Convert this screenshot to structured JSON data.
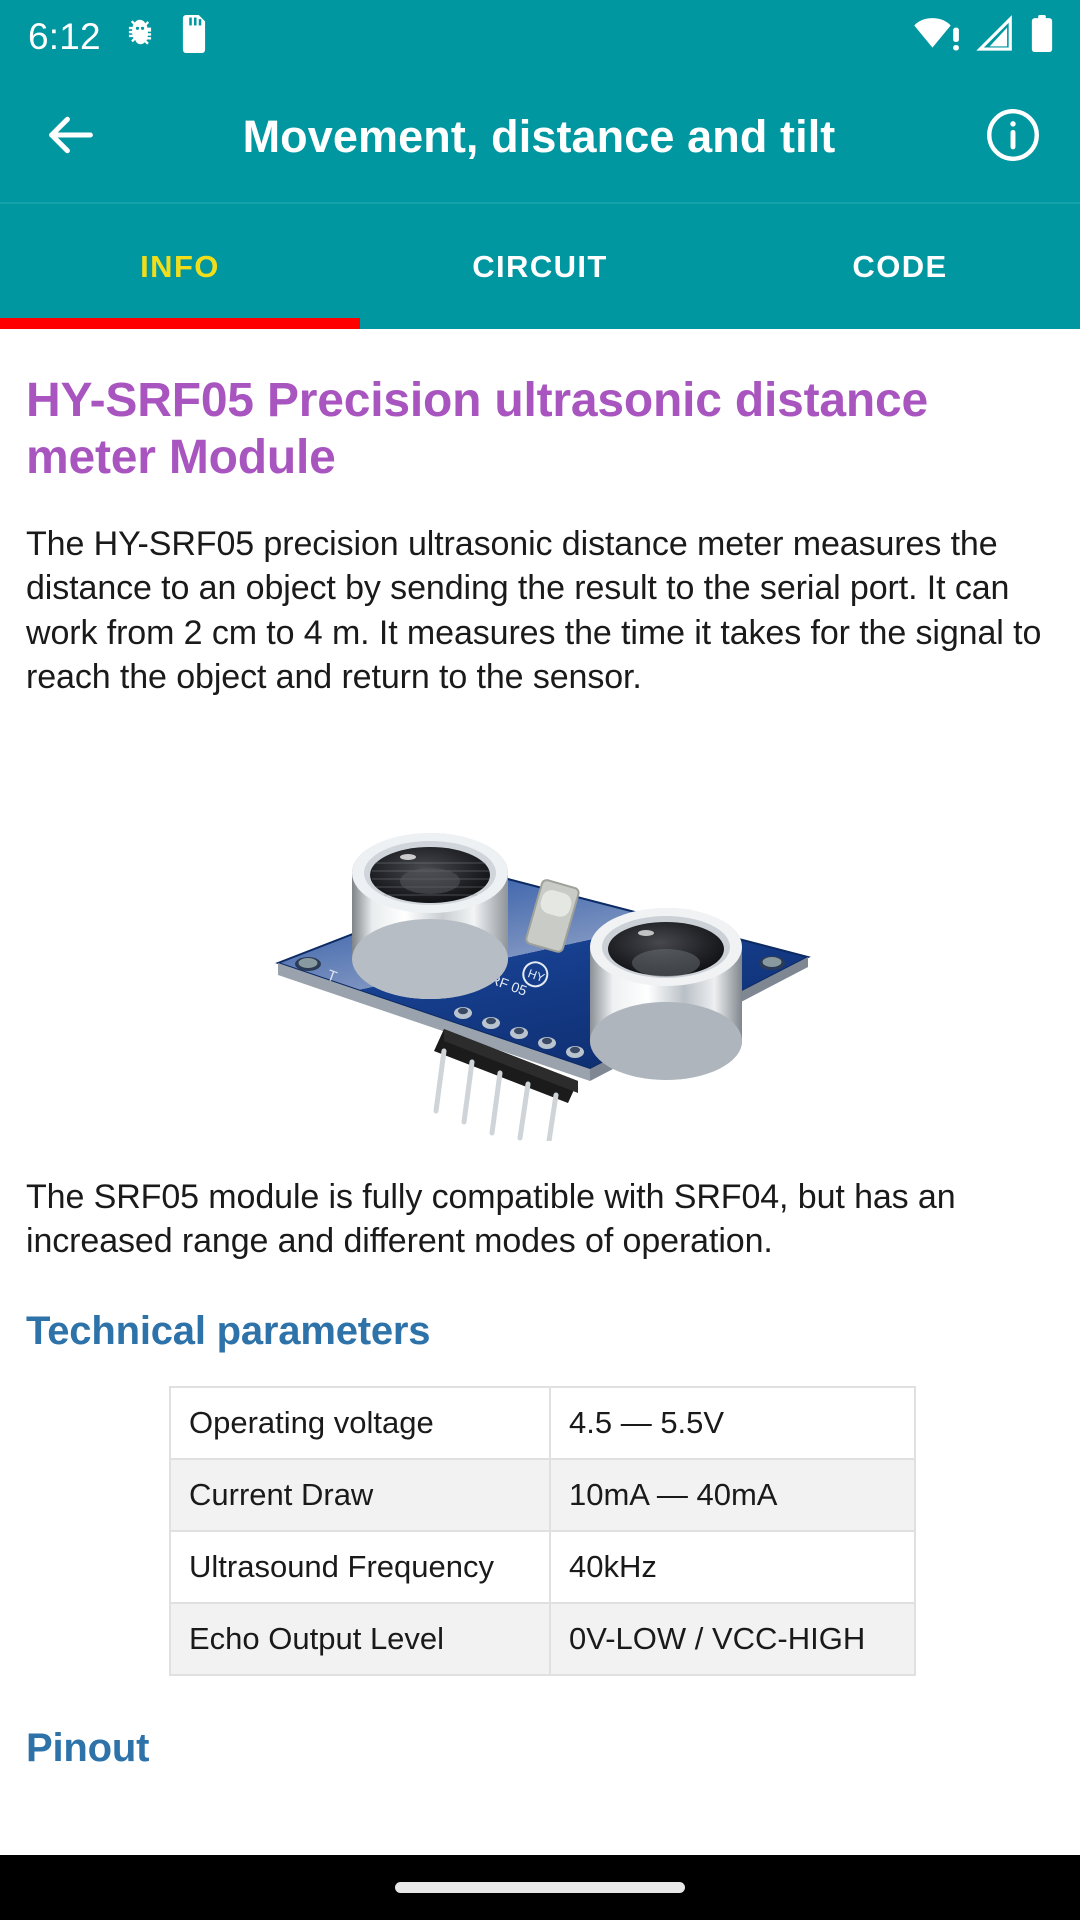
{
  "status_bar": {
    "clock": "6:12",
    "left_icons": [
      "debug-bug-icon",
      "sd-card-icon"
    ],
    "right_icons": [
      "wifi-no-internet-icon",
      "cellular-signal-icon",
      "battery-full-icon"
    ],
    "background_color": "#0097A0",
    "foreground_color": "#FFFFFF"
  },
  "app_bar": {
    "title": "Movement, distance and tilt",
    "back_icon": "arrow-left-icon",
    "info_icon": "info-circle-icon",
    "background_color": "#0097A0"
  },
  "tabs": {
    "items": [
      {
        "label": "INFO",
        "active": true
      },
      {
        "label": "CIRCUIT",
        "active": false
      },
      {
        "label": "CODE",
        "active": false
      }
    ],
    "active_color": "#F2DD1B",
    "inactive_color": "#FFFFFF",
    "indicator_color": "#FF0000"
  },
  "article": {
    "title": "HY-SRF05 Precision ultrasonic distance meter Module",
    "title_color": "#A855C0",
    "paragraph_1": "The HY-SRF05 precision ultrasonic distance meter measures the distance to an object by sending the result to the serial port. It can work from 2 cm to 4 m. It measures the time it takes for the signal to reach the object and return to the sensor.",
    "image_alt": "hy-srf05-ultrasonic-sensor-module-photo",
    "paragraph_2": "The SRF05 module is fully compatible with SRF04, but has an increased range and different modes of operation.",
    "heading_technical": "Technical parameters",
    "heading_pinout": "Pinout",
    "heading_color": "#2D72A8"
  },
  "spec_table": {
    "rows": [
      {
        "parameter": "Operating voltage",
        "value": "4.5 — 5.5V"
      },
      {
        "parameter": "Current Draw",
        "value": "10mA — 40mA"
      },
      {
        "parameter": "Ultrasound Frequency",
        "value": "40kHz"
      },
      {
        "parameter": "Echo Output Level",
        "value": "0V-LOW / VCC-HIGH"
      }
    ]
  },
  "nav_bar": {
    "gesture_pill": "home-gesture-pill",
    "background_color": "#000000"
  }
}
